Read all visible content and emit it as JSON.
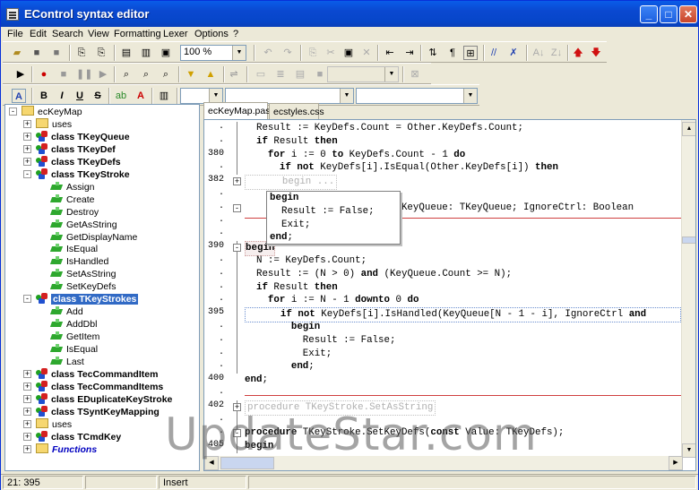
{
  "window": {
    "title": "EControl syntax editor"
  },
  "menu": [
    "File",
    "Edit",
    "Search",
    "View",
    "Formatting",
    "Lexer",
    "Options",
    "?"
  ],
  "toolbar": {
    "zoom": "100 %"
  },
  "tabs": [
    {
      "label": "ecKeyMap.pas"
    },
    {
      "label": "ecstyles.css"
    }
  ],
  "tree": {
    "items": [
      {
        "label": "ecKeyMap",
        "kind": "folder",
        "level": 0,
        "exp": "-"
      },
      {
        "label": "uses",
        "kind": "folder",
        "level": 1,
        "exp": "+"
      },
      {
        "label": "class TKeyQueue",
        "kind": "class",
        "level": 1,
        "exp": "+"
      },
      {
        "label": "class TKeyDef",
        "kind": "class",
        "level": 1,
        "exp": "+"
      },
      {
        "label": "class TKeyDefs",
        "kind": "class",
        "level": 1,
        "exp": "+"
      },
      {
        "label": "class TKeyStroke",
        "kind": "class",
        "level": 1,
        "exp": "-"
      },
      {
        "label": "Assign",
        "kind": "method",
        "level": 2
      },
      {
        "label": "Create",
        "kind": "method",
        "level": 2
      },
      {
        "label": "Destroy",
        "kind": "method",
        "level": 2
      },
      {
        "label": "GetAsString",
        "kind": "method",
        "level": 2
      },
      {
        "label": "GetDisplayName",
        "kind": "method",
        "level": 2
      },
      {
        "label": "IsEqual",
        "kind": "method",
        "level": 2
      },
      {
        "label": "IsHandled",
        "kind": "method",
        "level": 2
      },
      {
        "label": "SetAsString",
        "kind": "method",
        "level": 2
      },
      {
        "label": "SetKeyDefs",
        "kind": "method",
        "level": 2
      },
      {
        "label": "class TKeyStrokes",
        "kind": "class",
        "level": 1,
        "exp": "-",
        "selected": true
      },
      {
        "label": "Add",
        "kind": "method",
        "level": 2
      },
      {
        "label": "AddDbl",
        "kind": "method",
        "level": 2
      },
      {
        "label": "GetItem",
        "kind": "method",
        "level": 2
      },
      {
        "label": "IsEqual",
        "kind": "method",
        "level": 2
      },
      {
        "label": "Last",
        "kind": "method",
        "level": 2
      },
      {
        "label": "class TecCommandItem",
        "kind": "class",
        "level": 1,
        "exp": "+"
      },
      {
        "label": "class TecCommandItems",
        "kind": "class",
        "level": 1,
        "exp": "+"
      },
      {
        "label": "class EDuplicateKeyStroke",
        "kind": "class",
        "level": 1,
        "exp": "+"
      },
      {
        "label": "class TSyntKeyMapping",
        "kind": "class",
        "level": 1,
        "exp": "+"
      },
      {
        "label": "uses",
        "kind": "folder",
        "level": 1,
        "exp": "+"
      },
      {
        "label": "class TCmdKey",
        "kind": "class",
        "level": 1,
        "exp": "+"
      },
      {
        "label": "Functions",
        "kind": "italic",
        "level": 1,
        "exp": "+"
      }
    ]
  },
  "editor": {
    "gutter": [
      {
        "row": 0,
        "text": "."
      },
      {
        "row": 1,
        "text": "."
      },
      {
        "row": 2,
        "text": "380"
      },
      {
        "row": 3,
        "text": "."
      },
      {
        "row": 4,
        "text": "382"
      },
      {
        "row": 5,
        "text": "."
      },
      {
        "row": 6,
        "text": "."
      },
      {
        "row": 7,
        "text": "."
      },
      {
        "row": 8,
        "text": "."
      },
      {
        "row": 9,
        "text": "390"
      },
      {
        "row": 10,
        "text": "."
      },
      {
        "row": 11,
        "text": "."
      },
      {
        "row": 12,
        "text": "."
      },
      {
        "row": 13,
        "text": "."
      },
      {
        "row": 14,
        "text": "395"
      },
      {
        "row": 15,
        "text": "."
      },
      {
        "row": 16,
        "text": "."
      },
      {
        "row": 17,
        "text": "."
      },
      {
        "row": 18,
        "text": "."
      },
      {
        "row": 19,
        "text": "400"
      },
      {
        "row": 20,
        "text": "."
      },
      {
        "row": 21,
        "text": "402"
      },
      {
        "row": 22,
        "text": "."
      },
      {
        "row": 23,
        "text": "."
      },
      {
        "row": 24,
        "text": "405"
      }
    ],
    "lines": [
      "  Result := KeyDefs.Count = Other.KeyDefs.Count;",
      "  if Result then",
      "    for i := 0 to KeyDefs.Count - 1 do",
      "      if not KeyDefs[i].IsEqual(Other.KeyDefs[i]) then",
      "      begin ...",
      "",
      "                     ndled(KeyQueue: TKeyQueue; IgnoreCtrl: Boolean",
      "",
      "",
      "begin",
      "  N := KeyDefs.Count;",
      "  Result := (N > 0) and (KeyQueue.Count >= N);",
      "  if Result then",
      "    for i := N - 1 downto 0 do",
      "      if not KeyDefs[i].IsHandled(KeyQueue[N - 1 - i], IgnoreCtrl and",
      "        begin",
      "          Result := False;",
      "          Exit;",
      "        end;",
      "end;",
      "",
      "procedure TKeyStroke.SetAsString",
      "",
      "procedure TKeyStroke.SetKeyDefs(const Value: TKeyDefs);",
      "begin"
    ],
    "hint_lines": [
      "begin",
      "  Result := False;",
      "  Exit;",
      "end;"
    ]
  },
  "status": {
    "position": "21: 395",
    "mode": "Insert"
  },
  "watermark": "UpdateStar.com"
}
